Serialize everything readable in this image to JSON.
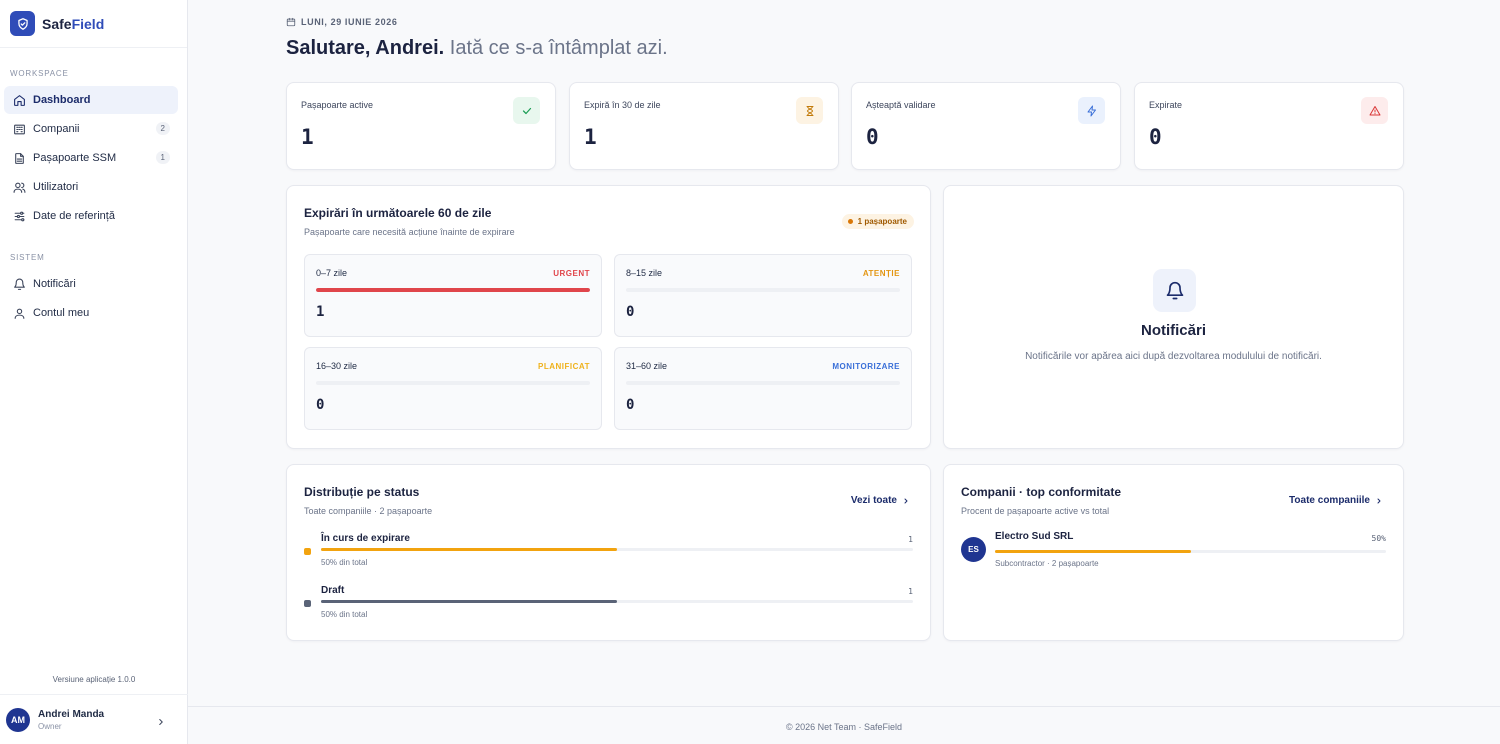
{
  "brand": {
    "name_part1": "Safe",
    "name_part2": "Field"
  },
  "sidebar": {
    "workspace_label": "WORKSPACE",
    "workspace_items": [
      {
        "label": "Dashboard",
        "icon": "home-icon"
      },
      {
        "label": "Companii",
        "icon": "building-icon",
        "count": "2"
      },
      {
        "label": "Pașapoarte SSM",
        "icon": "document-icon",
        "count": "1"
      },
      {
        "label": "Utilizatori",
        "icon": "users-icon"
      },
      {
        "label": "Date de referință",
        "icon": "sliders-icon"
      }
    ],
    "system_label": "SISTEM",
    "system_items": [
      {
        "label": "Notificări",
        "icon": "bell-icon"
      },
      {
        "label": "Contul meu",
        "icon": "user-icon"
      }
    ],
    "version": "Versiune aplicație 1.0.0",
    "user": {
      "initials": "AM",
      "name": "Andrei Manda",
      "role": "Owner"
    }
  },
  "header": {
    "date": "LUNI, 29 IUNIE 2026",
    "greeting_bold": "Salutare, Andrei.",
    "greeting_rest": " Iată ce s-a întâmplat azi."
  },
  "stats": [
    {
      "label": "Pașapoarte active",
      "value": "1",
      "icon": "check-icon",
      "icon_bg": "#e8f7ee",
      "icon_color": "#1e9e57"
    },
    {
      "label": "Expiră în 30 de zile",
      "value": "1",
      "icon": "hourglass-icon",
      "icon_bg": "#fdf3e3",
      "icon_color": "#c27a0a"
    },
    {
      "label": "Așteaptă validare",
      "value": "0",
      "icon": "lightning-icon",
      "icon_bg": "#eaf1fd",
      "icon_color": "#3a6fd8"
    },
    {
      "label": "Expirate",
      "value": "0",
      "icon": "warning-icon",
      "icon_bg": "#fdecec",
      "icon_color": "#d93636"
    }
  ],
  "expirations": {
    "title": "Expirări în următoarele 60 de zile",
    "subtitle": "Pașapoarte care necesită acțiune înainte de expirare",
    "badge": "1 pașapoarte",
    "buckets": [
      {
        "range": "0–7 zile",
        "tag": "URGENT",
        "count": "1",
        "fill": 1.0,
        "color": "#e0454b"
      },
      {
        "range": "8–15 zile",
        "tag": "ATENȚIE",
        "count": "0",
        "fill": 0,
        "color": "#f2a30f"
      },
      {
        "range": "16–30 zile",
        "tag": "PLANIFICAT",
        "count": "0",
        "fill": 0,
        "color": "#f2b21b"
      },
      {
        "range": "31–60 zile",
        "tag": "MONITORIZARE",
        "count": "0",
        "fill": 0,
        "color": "#3a6fd8"
      }
    ]
  },
  "notifications": {
    "title": "Notificări",
    "text": "Notificările vor apărea aici după dezvoltarea modulului de notificări."
  },
  "distribution": {
    "title": "Distribuție pe status",
    "subtitle": "Toate companiile · 2 pașapoarte",
    "link": "Vezi toate",
    "rows": [
      {
        "name": "În curs de expirare",
        "count": "1",
        "pct_text": "50% din total",
        "fraction": 0.5,
        "color": "#f2a30f"
      },
      {
        "name": "Draft",
        "count": "1",
        "pct_text": "50% din total",
        "fraction": 0.5,
        "color": "#5a6377"
      }
    ]
  },
  "companies": {
    "title": "Companii · top conformitate",
    "subtitle": "Procent de pașapoarte active vs total",
    "link": "Toate companiile",
    "rows": [
      {
        "initials": "ES",
        "name": "Electro Sud SRL",
        "pct": "50%",
        "fraction": 0.5,
        "meta": "Subcontractor · 2 pașapoarte"
      }
    ]
  },
  "footer": {
    "text": "© 2026 Net Team · SafeField"
  }
}
